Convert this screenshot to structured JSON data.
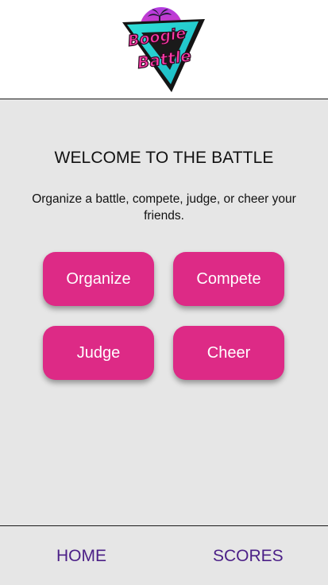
{
  "header": {
    "logo_text_line1": "Boogie",
    "logo_text_line2": "Battle"
  },
  "main": {
    "title": "WELCOME TO THE BATTLE",
    "description": "Organize a battle, compete, judge, or cheer your friends.",
    "buttons": {
      "organize": "Organize",
      "compete": "Compete",
      "judge": "Judge",
      "cheer": "Cheer"
    }
  },
  "footer": {
    "home": "HOME",
    "scores": "SCORES"
  },
  "colors": {
    "button": "#dd2a86",
    "nav": "#4b1f87",
    "background": "#e6e6e6"
  }
}
